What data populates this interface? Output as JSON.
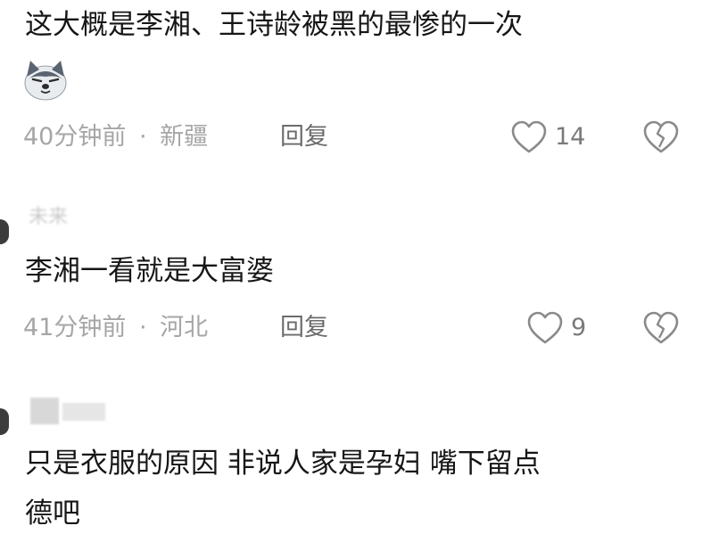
{
  "comments": [
    {
      "text": "这大概是李湘、王诗龄被黑的最惨的一次",
      "emoji": "husky-emoji",
      "time": "40分钟前",
      "separator": "·",
      "location": "新疆",
      "reply_label": "回复",
      "likes": "14"
    },
    {
      "username": "未来",
      "text": "李湘一看就是大富婆",
      "time": "41分钟前",
      "separator": "·",
      "location": "河北",
      "reply_label": "回复",
      "likes": "9"
    },
    {
      "text_line1": "只是衣服的原因 非说人家是孕妇 嘴下留点",
      "text_line2": "德吧"
    }
  ],
  "colors": {
    "text": "#161616",
    "meta": "#a6a6a6",
    "icon": "#8a8a8a"
  }
}
